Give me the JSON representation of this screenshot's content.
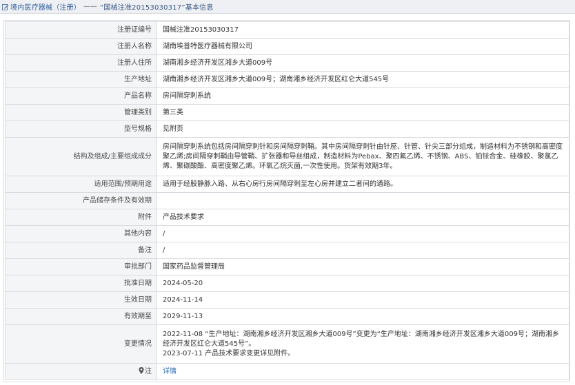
{
  "header": {
    "crumb": "境内医疗器械（注册）",
    "separator": "——",
    "title": "“国械注准20153030317”基本信息"
  },
  "rows": [
    {
      "label": "注册证编号",
      "value": "国械注准20153030317"
    },
    {
      "label": "注册人名称",
      "value": "湖南埃普特医疗器械有限公司"
    },
    {
      "label": "注册人住所",
      "value": "湖南湘乡经济开发区湘乡大道009号"
    },
    {
      "label": "生产地址",
      "value": "湖南湘乡经济开发区湘乡大道009号；湖南湘乡经济开发区红仑大道545号"
    },
    {
      "label": "产品名称",
      "value": "房间隔穿刺系统"
    },
    {
      "label": "管理类别",
      "value": "第三类"
    },
    {
      "label": "型号规格",
      "value": "见附页"
    },
    {
      "label": "结构及组成/主要组成成分",
      "value": "房间隔穿刺系统包括房间隔穿刺针和房间隔穿刺鞘。其中房间隔穿刺针由针座、针管、针尖三部分组成，制造材料为不锈钢和高密度聚乙烯;房间隔穿刺鞘由导管鞘、扩张器和导丝组成，制造材料为Pebax、聚四氟乙烯、不锈钢、ABS、铂铱合金、硅橡胶、聚氯乙烯、聚碳酸酯、高密度聚乙烯。环氧乙烷灭菌,一次性使用。货架有效期3年。"
    },
    {
      "label": "适用范围/预期用途",
      "value": "适用于经股静脉入路、从右心房行房间隔穿刺至左心房并建立二者间的通路。"
    },
    {
      "label": "产品储存条件及有效期",
      "value": ""
    },
    {
      "label": "附件",
      "value": "产品技术要求"
    },
    {
      "label": "其他内容",
      "value": "/"
    },
    {
      "label": "备注",
      "value": "/"
    },
    {
      "label": "审批部门",
      "value": "国家药品监督管理局"
    },
    {
      "label": "批准日期",
      "value": "2024-05-20"
    },
    {
      "label": "生效日期",
      "value": "2024-11-14"
    },
    {
      "label": "有效期至",
      "value": "2029-11-13"
    }
  ],
  "changes": {
    "label": "变更情况",
    "line1": "2022-11-08 “生产地址：湖南湘乡经济开发区湘乡大道009号”变更为“生产地址：湖南湘乡经济开发区湘乡大道009号；湖南湘乡经济开发区红仑大道545号”。",
    "line2": "2023-07-11 产品技术要求变更详见附件。"
  },
  "detail": {
    "label": "注",
    "link": "详情",
    "icon": "pin-icon"
  },
  "colors": {
    "header_bg": "#eef0f3",
    "label_bg": "#f4f5f7",
    "border": "#d8dbe0",
    "link": "#2f6db5"
  }
}
